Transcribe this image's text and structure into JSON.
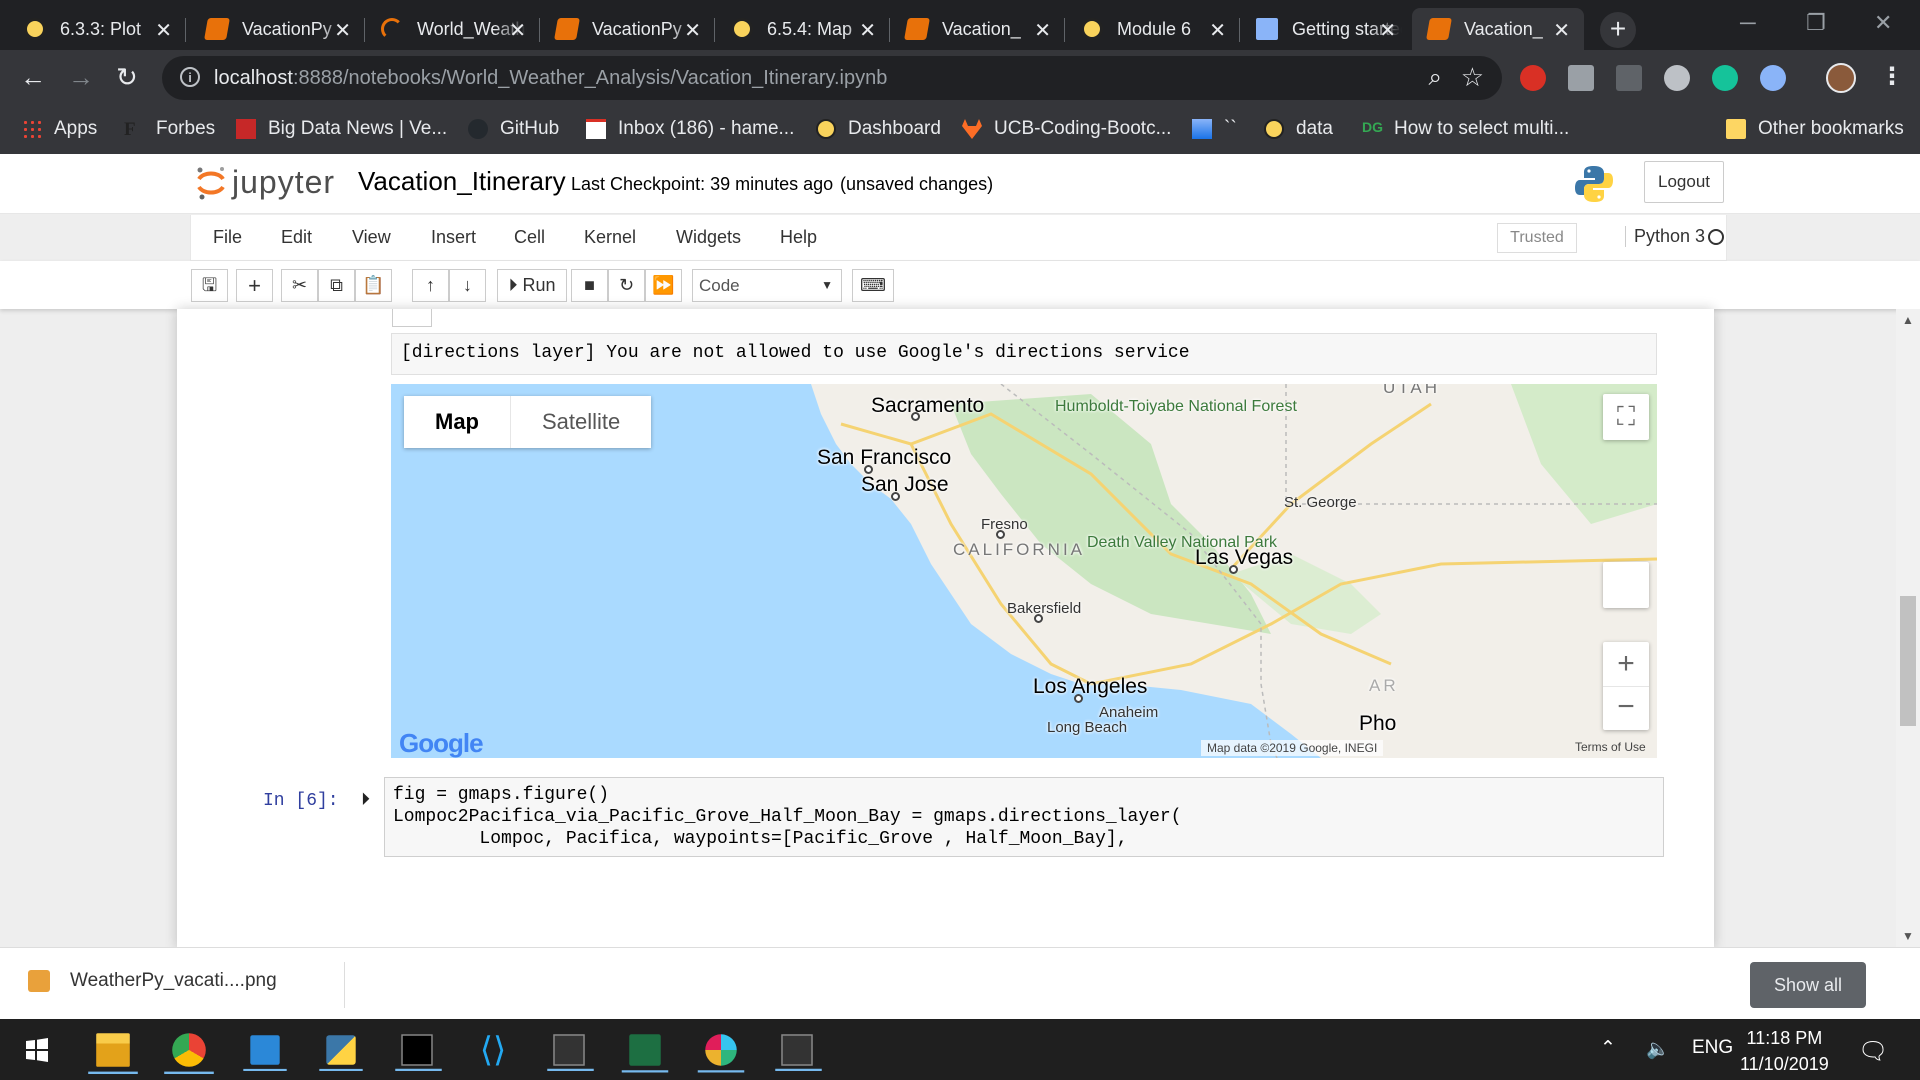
{
  "browser": {
    "tabs": [
      {
        "title": "6.3.3: Plot",
        "icon": "jupyter-icon"
      },
      {
        "title": "VacationPy",
        "icon": "notebook-icon"
      },
      {
        "title": "World_Weather",
        "icon": "loading-icon"
      },
      {
        "title": "VacationPy",
        "icon": "notebook-icon"
      },
      {
        "title": "6.5.4: Map",
        "icon": "jupyter-icon"
      },
      {
        "title": "Vacation_",
        "icon": "notebook-icon"
      },
      {
        "title": "Module 6",
        "icon": "jupyter-icon"
      },
      {
        "title": "Getting started",
        "icon": "doc-icon"
      },
      {
        "title": "Vacation_",
        "icon": "notebook-icon"
      }
    ],
    "new_tab": "+",
    "window_controls": {
      "minimize": "─",
      "restore": "❐",
      "close": "✕"
    },
    "url_host": "localhost",
    "url_path": ":8888/notebooks/World_Weather_Analysis/Vacation_Itinerary.ipynb",
    "bookmarks": [
      {
        "label": "Apps"
      },
      {
        "label": "Forbes"
      },
      {
        "label": "Big Data News | Ve..."
      },
      {
        "label": "GitHub"
      },
      {
        "label": "Inbox (186) - hame..."
      },
      {
        "label": "Dashboard"
      },
      {
        "label": "UCB-Coding-Bootc..."
      },
      {
        "label": "``"
      },
      {
        "label": "data"
      },
      {
        "label": "How to select multi..."
      }
    ],
    "other_bookmarks": "Other bookmarks"
  },
  "jupyter": {
    "logo_text": "jupyter",
    "notebook_name": "Vacation_Itinerary",
    "checkpoint": "Last Checkpoint: 39 minutes ago",
    "unsaved": "(unsaved changes)",
    "logout": "Logout",
    "menu": [
      "File",
      "Edit",
      "View",
      "Insert",
      "Cell",
      "Kernel",
      "Widgets",
      "Help"
    ],
    "trusted": "Trusted",
    "kernel": "Python 3",
    "toolbar": {
      "run": "Run",
      "cell_type": "Code"
    },
    "error_text": "[directions layer] You are not allowed to use Google's directions service",
    "map": {
      "type_buttons": [
        "Map",
        "Satellite"
      ],
      "labels": {
        "sacramento": "Sacramento",
        "san_francisco": "San Francisco",
        "san_jose": "San Jose",
        "fresno": "Fresno",
        "california": "CALIFORNIA",
        "bakersfield": "Bakersfield",
        "los_angeles": "Los Angeles",
        "anaheim": "Anaheim",
        "long_beach": "Long Beach",
        "las_vegas": "Las Vegas",
        "st_george": "St. George",
        "humboldt": "Humboldt-Toiyabe National Forest",
        "death_valley": "Death Valley National Park",
        "utah": "UTAH",
        "ari": "AR",
        "phoenix": "Pho"
      },
      "google": "Google",
      "attribution": "Map data ©2019 Google, INEGI",
      "terms": "Terms of Use",
      "zoom_in": "+",
      "zoom_out": "−"
    },
    "in_prompt": "In [6]:",
    "code_lines": [
      "fig = gmaps.figure()",
      "Lompoc2Pacifica_via_Pacific_Grove_Half_Moon_Bay = gmaps.directions_layer(",
      "        Lompoc, Pacifica, waypoints=[Pacific_Grove , Half_Moon_Bay],"
    ]
  },
  "downloads": {
    "file": "WeatherPy_vacati....png",
    "show_all": "Show all"
  },
  "taskbar": {
    "lang": "ENG",
    "time": "11:18 PM",
    "date": "11/10/2019"
  }
}
